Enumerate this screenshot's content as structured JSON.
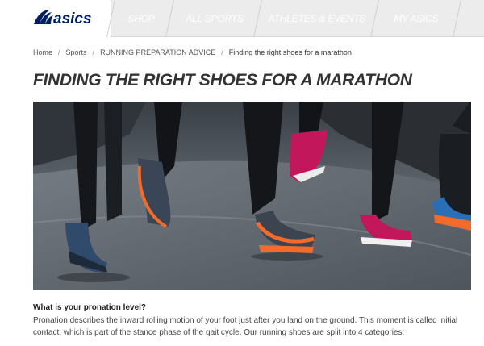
{
  "brand": {
    "logo_text": "asics"
  },
  "nav": {
    "tabs": [
      {
        "label": "SHOP"
      },
      {
        "label": "ALL SPORTS"
      },
      {
        "label": "ATHLETES & EVENTS"
      },
      {
        "label": "MY ASICS"
      }
    ]
  },
  "breadcrumb": {
    "items": [
      "Home",
      "Sports",
      "RUNNING PREPARATION ADVICE"
    ],
    "current": "Finding the right shoes for a marathon",
    "separator": "/"
  },
  "page": {
    "title": "FINDING THE RIGHT SHOES FOR A MARATHON"
  },
  "content": {
    "heading": "What is your pronation level?",
    "paragraph": "Pronation describes the inward rolling motion of your foot just after you land on the ground. This moment is called initial contact, which is part of the stance phase of the gait cycle. Our running shoes are split into 4 categories:"
  },
  "colors": {
    "brand_blue": "#001e62",
    "nav_bg": "#ececec",
    "shoe_orange": "#f26b2a",
    "shoe_pink": "#c2185b",
    "shoe_blue": "#2a6fb5"
  }
}
